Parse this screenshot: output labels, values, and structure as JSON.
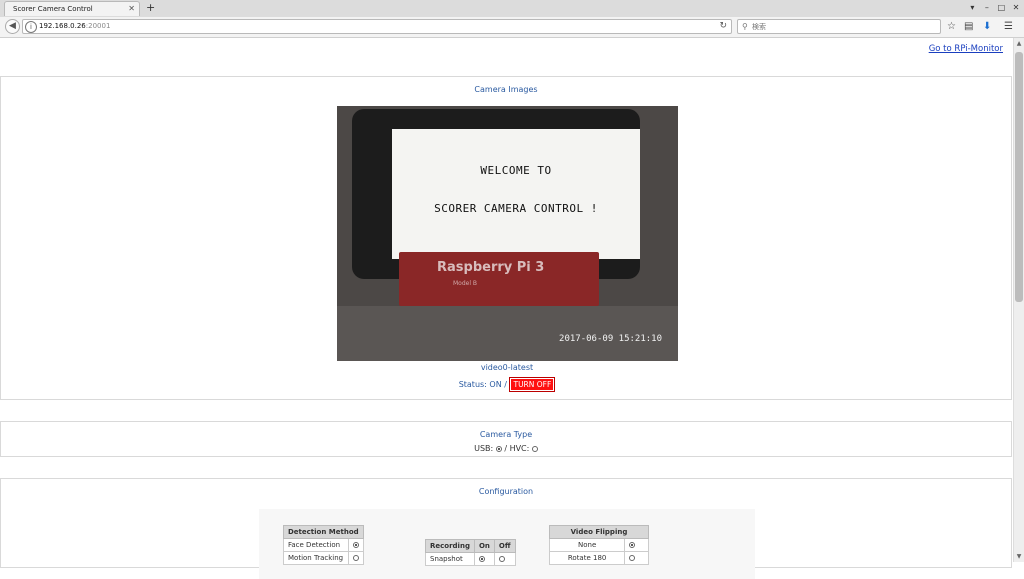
{
  "browser": {
    "tab_title": "Scorer Camera Control",
    "new_tab": "+",
    "url_host": "192.168.0.26",
    "url_port": ":20001",
    "search_placeholder": "検索"
  },
  "header": {
    "rpi_link": "Go to RPi-Monitor"
  },
  "camera_images": {
    "title": "Camera Images",
    "image_text_line1": "WELCOME TO",
    "image_text_line2": "SCORER CAMERA CONTROL !",
    "image_board_label": "Raspberry Pi 3",
    "image_board_sub": "Model B",
    "timestamp": "2017-06-09 15:21:10",
    "caption": "video0-latest",
    "status_text": "Status: ON /",
    "turn_off_label": "TURN OFF"
  },
  "camera_type": {
    "title": "Camera Type",
    "usb_label": "USB:",
    "separator": "/ HVC:",
    "selected": "USB"
  },
  "configuration": {
    "title": "Configuration",
    "detection": {
      "header": "Detection Method",
      "rows": [
        "Face Detection",
        "Motion Tracking"
      ]
    },
    "recording": {
      "header": "Recording",
      "on": "On",
      "off": "Off",
      "rows": [
        "Snapshot"
      ]
    },
    "flipping": {
      "header": "Video Flipping",
      "rows": [
        "None",
        "Rotate 180"
      ]
    }
  }
}
